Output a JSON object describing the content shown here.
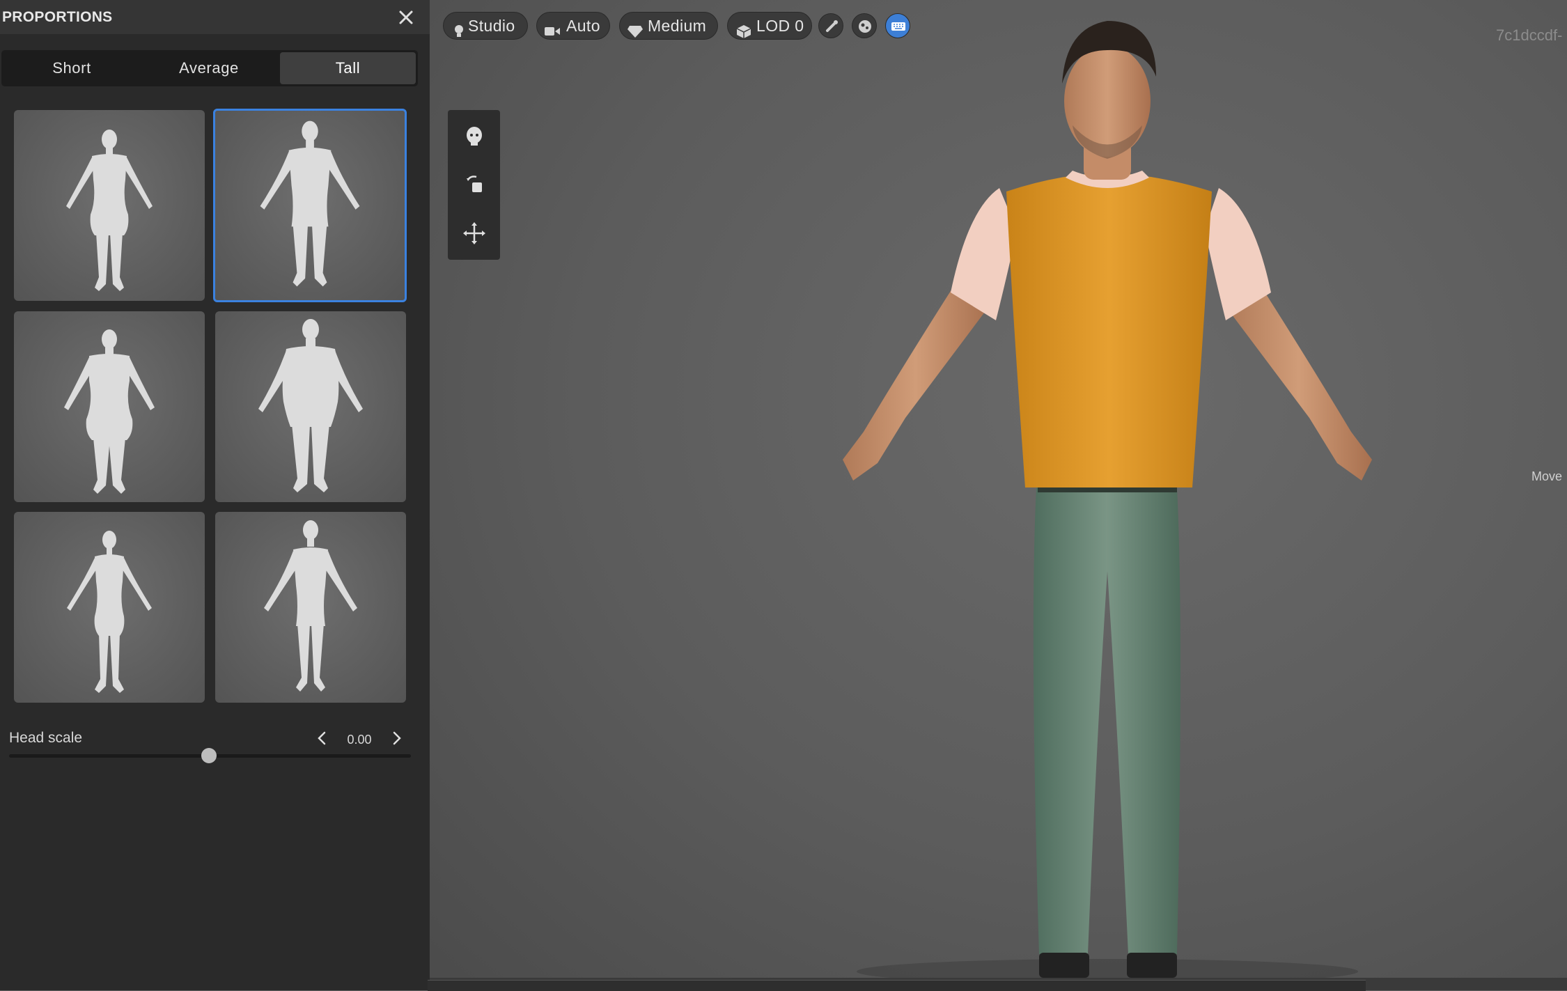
{
  "panel": {
    "title": "PROPORTIONS",
    "tabs": [
      {
        "label": "Short",
        "active": false
      },
      {
        "label": "Average",
        "active": false
      },
      {
        "label": "Tall",
        "active": true
      }
    ],
    "presets": [
      {
        "name": "female-slim",
        "selected": false
      },
      {
        "name": "male-slim",
        "selected": true
      },
      {
        "name": "female-heavy",
        "selected": false
      },
      {
        "name": "male-heavy",
        "selected": false
      },
      {
        "name": "female-thin",
        "selected": false
      },
      {
        "name": "male-thin",
        "selected": false
      }
    ],
    "head_scale": {
      "label": "Head scale",
      "value": "0.00",
      "slider_fraction": 0.5
    }
  },
  "toolbar": {
    "lighting": {
      "label": "Studio",
      "icon": "bulb-icon"
    },
    "camera": {
      "label": "Auto",
      "icon": "camera-icon"
    },
    "quality": {
      "label": "Medium",
      "icon": "diamond-icon"
    },
    "lod": {
      "label": "LOD 0",
      "icon": "cube-icon"
    },
    "icons": [
      "bone-icon",
      "skin-icon",
      "keyboard-icon"
    ]
  },
  "viewport": {
    "session_id": "7c1dccdf-",
    "move_label": "Move",
    "tools": [
      "head-icon",
      "rotate-icon",
      "move-icon"
    ],
    "colors": {
      "accent": "#3d7fd6",
      "shirt": "#e09a2c",
      "sleeves": "#f3d3c6",
      "jeans": "#6f8b7a"
    }
  }
}
